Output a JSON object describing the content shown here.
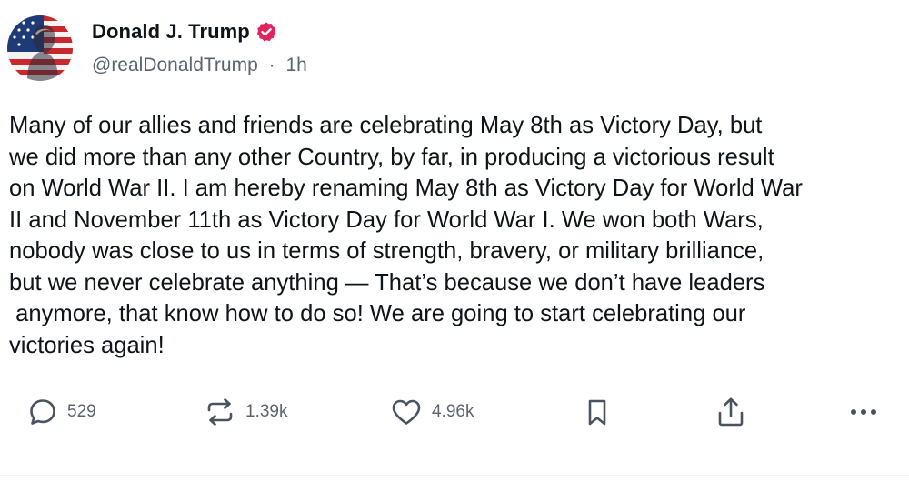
{
  "post": {
    "author": {
      "display_name": "Donald J. Trump",
      "handle": "@realDonaldTrump",
      "separator": "·",
      "time_ago": "1h",
      "verified": true,
      "verified_color": "#e0245e"
    },
    "text_lines": [
      "Many of our allies and friends are celebrating May 8th as Victory Day, but",
      "we did more than any other Country, by far, in producing a victorious result",
      "on World War II. I am hereby renaming May 8th as Victory Day for World War",
      "II and November 11th as Victory Day for World War I. We won both Wars,",
      "nobody was close to us in terms of strength, bravery, or military brilliance,",
      "but we never celebrate anything — That’s because we don’t have leaders",
      " anymore, that know how to do so! We are going to start celebrating our",
      "victories again!"
    ],
    "actions": {
      "reply": {
        "icon": "speech-bubble-icon",
        "count": "529"
      },
      "retruth": {
        "icon": "repost-arrows-icon",
        "count": "1.39k"
      },
      "like": {
        "icon": "heart-icon",
        "count": "4.96k"
      },
      "bookmark": {
        "icon": "bookmark-icon"
      },
      "share": {
        "icon": "share-upload-icon"
      },
      "more": {
        "icon": "more-horizontal-icon"
      }
    }
  },
  "colors": {
    "text": "#0f1419",
    "secondary": "#5b6470",
    "icon": "#4a5461"
  }
}
